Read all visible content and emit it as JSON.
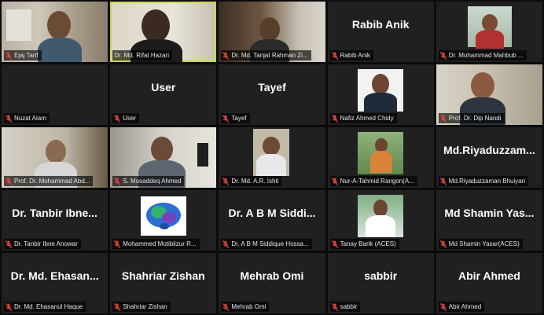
{
  "colors": {
    "active_border": "#c9d846",
    "mic_muted": "#e0403a",
    "tile_bg": "#202020"
  },
  "tiles": [
    {
      "label": "Ejaj Tarif",
      "center": "",
      "type": "video"
    },
    {
      "label": "Dr. Md. Rifat Hazari",
      "center": "",
      "type": "video",
      "active": true
    },
    {
      "label": "Dr. Md. Tanjat Rahman Zi...",
      "center": "",
      "type": "video"
    },
    {
      "label": "Rabib Anik",
      "center": "Rabib Anik",
      "type": "name"
    },
    {
      "label": "Dr. Mohammad Mahbub ...",
      "center": "",
      "type": "video-small"
    },
    {
      "label": "Nuzat Alam",
      "center": "",
      "type": "blank"
    },
    {
      "label": "User",
      "center": "User",
      "type": "name"
    },
    {
      "label": "Tayef",
      "center": "Tayef",
      "type": "name"
    },
    {
      "label": "Nafiz Ahmed Chidy",
      "center": "",
      "type": "photo"
    },
    {
      "label": "Prof. Dr. Dip Nandi",
      "center": "",
      "type": "video"
    },
    {
      "label": "Prof. Dr. Mohammad Abd...",
      "center": "",
      "type": "video"
    },
    {
      "label": "S. Mosaddeq Ahmed",
      "center": "",
      "type": "video"
    },
    {
      "label": "Dr. Md. A.R. Ishti",
      "center": "",
      "type": "photo"
    },
    {
      "label": "Nur-A-Tahmid Rangon(A...",
      "center": "",
      "type": "photo-green"
    },
    {
      "label": "Md.Riyaduzzaman Bhuiyan",
      "center": "Md.Riyaduzzam...",
      "type": "name"
    },
    {
      "label": "Dr. Tanbir Ibne Anowar",
      "center": "Dr. Tanbir Ibne...",
      "type": "name"
    },
    {
      "label": "Mohammed Motiblizur R...",
      "center": "",
      "type": "brain"
    },
    {
      "label": "Dr. A B M Siddique Hossa...",
      "center": "Dr. A B M Siddi...",
      "type": "name"
    },
    {
      "label": "Tanay Barik (ACES)",
      "center": "",
      "type": "photo-green"
    },
    {
      "label": "Md Shamin Yasar(ACES)",
      "center": "Md Shamin Yas...",
      "type": "name"
    },
    {
      "label": "Dr. Md. Ehasanul Haque",
      "center": "Dr. Md. Ehasan...",
      "type": "name"
    },
    {
      "label": "Shahriar Zishan",
      "center": "Shahriar Zishan",
      "type": "name"
    },
    {
      "label": "Mehrab Omi",
      "center": "Mehrab Omi",
      "type": "name"
    },
    {
      "label": "sabbir",
      "center": "sabbir",
      "type": "name"
    },
    {
      "label": "Abir Ahmed",
      "center": "Abir Ahmed",
      "type": "name"
    }
  ]
}
